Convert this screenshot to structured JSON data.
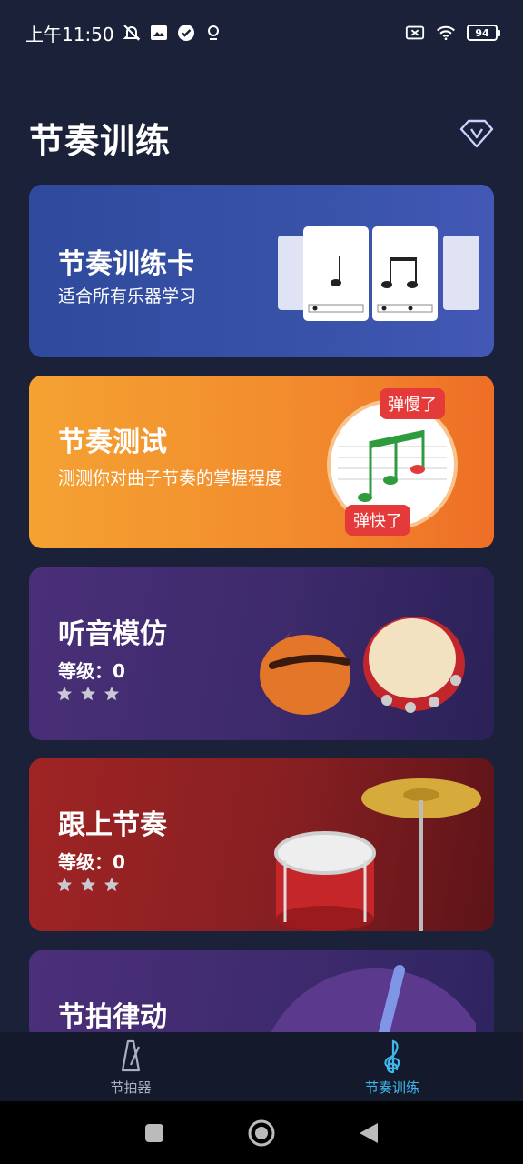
{
  "status": {
    "time": "上午11:50",
    "battery": "94"
  },
  "header": {
    "title": "节奏训练"
  },
  "cards": [
    {
      "title": "节奏训练卡",
      "subtitle": "适合所有乐器学习"
    },
    {
      "title": "节奏测试",
      "subtitle": "测测你对曲子节奏的掌握程度",
      "badge_slow": "弹慢了",
      "badge_fast": "弹快了"
    },
    {
      "title": "听音模仿",
      "level": "等级：0",
      "stars": 3
    },
    {
      "title": "跟上节奏",
      "level": "等级：0",
      "stars": 3
    },
    {
      "title": "节拍律动"
    }
  ],
  "nav": {
    "items": [
      {
        "label": "节拍器",
        "active": false
      },
      {
        "label": "节奏训练",
        "active": true
      }
    ],
    "active_color": "#3fb7ea"
  },
  "icons": {
    "vip": "diamond-v-icon",
    "metronome": "metronome-icon",
    "treble_clef": "treble-clef-icon"
  }
}
